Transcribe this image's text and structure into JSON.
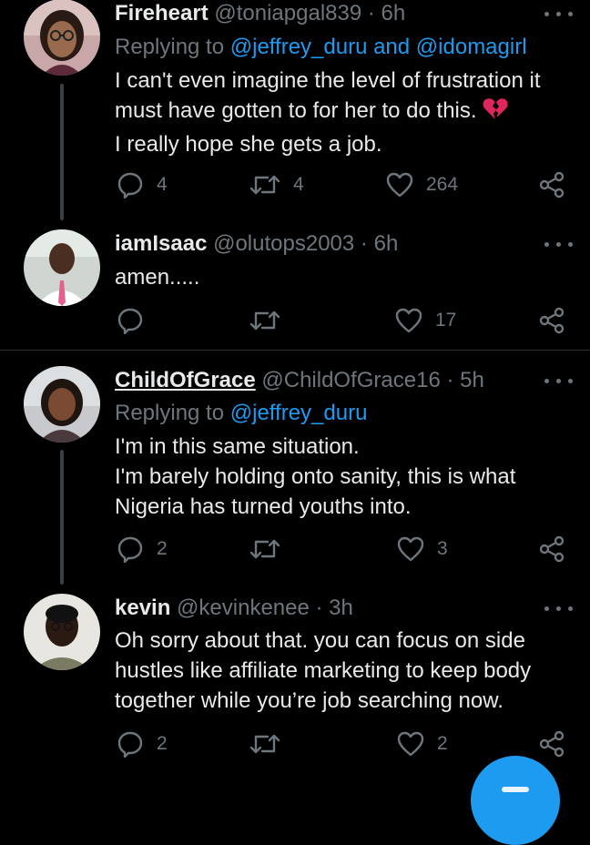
{
  "tweets": [
    {
      "name": "Fireheart",
      "handle": "@toniapgal839",
      "dot": "·",
      "time": "6h",
      "replying_prefix": "Replying to",
      "replying_mentions": "@jeffrey_duru and @idomagirl",
      "lines": [
        "I can't even imagine the level of frustration it",
        "must have gotten to for her to do this.",
        "I really hope she gets a job."
      ],
      "reply_count": "4",
      "retweet_count": "4",
      "like_count": "264"
    },
    {
      "name": "iamIsaac",
      "handle": "@olutops2003",
      "dot": "·",
      "time": "6h",
      "lines": [
        "amen....."
      ],
      "reply_count": "",
      "retweet_count": "",
      "like_count": "17"
    },
    {
      "name": "ChildOfGrace",
      "handle": "@ChildOfGrace16",
      "dot": "·",
      "time": "5h",
      "replying_prefix": "Replying to",
      "replying_mentions": "@jeffrey_duru",
      "lines": [
        "I'm in this same situation.",
        "I'm barely holding onto sanity, this is what",
        "Nigeria has turned youths into."
      ],
      "reply_count": "2",
      "retweet_count": "",
      "like_count": "3"
    },
    {
      "name": "kevin",
      "handle": "@kevinkenee",
      "dot": "·",
      "time": "3h",
      "lines": [
        "Oh sorry about that. you can focus on side",
        "hustles like affiliate marketing to keep body",
        "together while you’re job searching now."
      ],
      "reply_count": "2",
      "retweet_count": "",
      "like_count": "2"
    }
  ],
  "icons": {
    "reply": "reply-icon",
    "retweet": "retweet-icon",
    "like": "heart-icon",
    "share": "share-icon",
    "more": "more-icon",
    "emoji": "broken-heart-emoji"
  },
  "colors": {
    "background": "#000000",
    "text": "#e7e9ea",
    "secondary": "#6e767d",
    "link": "#1d9bf0",
    "fab": "#1d9bf0",
    "emoji": "#e0245e"
  }
}
